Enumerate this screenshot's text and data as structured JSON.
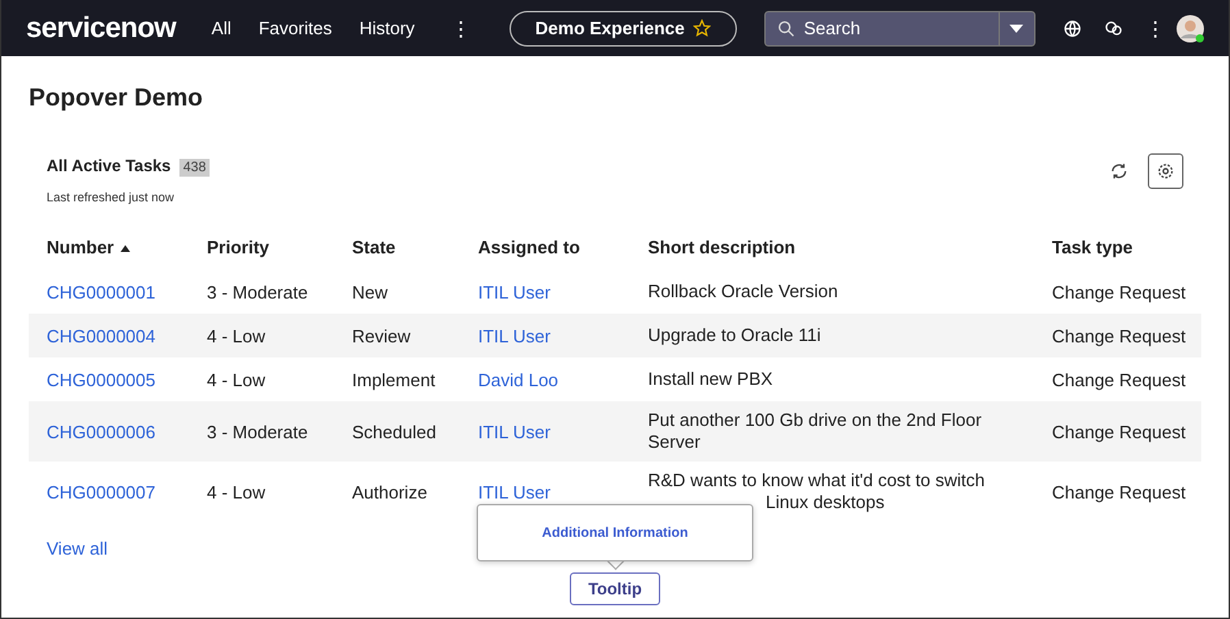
{
  "nav": {
    "logo": "servicenow",
    "links": [
      {
        "label": "All"
      },
      {
        "label": "Favorites"
      },
      {
        "label": "History"
      }
    ],
    "more": "⋮",
    "experience": "Demo Experience",
    "search": {
      "placeholder": "Search"
    },
    "menu": "⋮"
  },
  "page": {
    "title": "Popover Demo"
  },
  "list": {
    "title": "All Active Tasks",
    "count": "438",
    "subtitle": "Last refreshed just now",
    "columns": [
      {
        "label": "Number",
        "sorted": true
      },
      {
        "label": "Priority",
        "sorted": false
      },
      {
        "label": "State",
        "sorted": false
      },
      {
        "label": "Assigned to",
        "sorted": false
      },
      {
        "label": "Short description",
        "sorted": false
      },
      {
        "label": "Task type",
        "sorted": false
      }
    ],
    "rows": [
      {
        "number": "CHG0000001",
        "priority": "3 - Moderate",
        "state": "New",
        "assigned": "ITIL User",
        "description": "Rollback Oracle Version",
        "type": "Change Request"
      },
      {
        "number": "CHG0000004",
        "priority": "4 - Low",
        "state": "Review",
        "assigned": "ITIL User",
        "description": "Upgrade to Oracle 11i",
        "type": "Change Request"
      },
      {
        "number": "CHG0000005",
        "priority": "4 - Low",
        "state": "Implement",
        "assigned": "David Loo",
        "description": "Install new PBX",
        "type": "Change Request"
      },
      {
        "number": "CHG0000006",
        "priority": "3 - Moderate",
        "state": "Scheduled",
        "assigned": "ITIL User",
        "description": "Put another 100 Gb drive on the 2nd Floor Server",
        "type": "Change Request"
      },
      {
        "number": "CHG0000007",
        "priority": "4 - Low",
        "state": "Authorize",
        "assigned": "ITIL User",
        "description": "R&D wants to know what it'd cost to switch",
        "description_tail": "Linux desktops",
        "type": "Change Request"
      }
    ],
    "view_all": "View all"
  },
  "popover": {
    "text": "Additional Information",
    "button": "Tooltip"
  }
}
